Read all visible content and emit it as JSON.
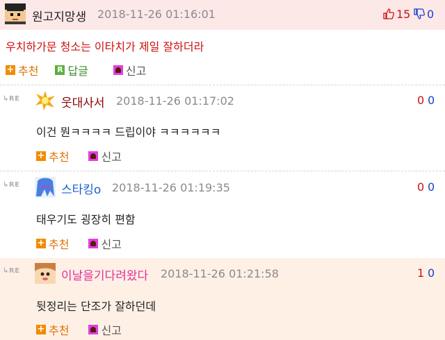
{
  "post": {
    "author": "원고지망생",
    "date": "2018-11-26 01:16:01",
    "like_count": "15",
    "dislike_count": "0",
    "text": "우치하가문 청소는 이타치가 제일 잘하더라",
    "recommend_label": "추천",
    "reply_label": "답글",
    "report_label": "신고"
  },
  "replies": [
    {
      "re_label": "RE",
      "author": "웃대사서",
      "date": "2018-11-26 01:17:02",
      "up": "0",
      "down": "0",
      "text": "이건 뭔ㅋㅋㅋㅋ 드립이야 ㅋㅋㅋㅋㅋㅋ",
      "recommend_label": "추천",
      "report_label": "신고"
    },
    {
      "re_label": "RE",
      "author": "스타킹o",
      "date": "2018-11-26 01:19:35",
      "up": "0",
      "down": "0",
      "text": "태우기도 굉장히 편함",
      "recommend_label": "추천",
      "report_label": "신고"
    },
    {
      "re_label": "RE",
      "author": "이날을기다려왔다",
      "date": "2018-11-26 01:21:58",
      "up": "1",
      "down": "0",
      "text": "뒷정리는 단조가 잘하던데",
      "recommend_label": "추천",
      "report_label": "신고"
    }
  ],
  "colors": {
    "post_header_bg": "#fde8e8",
    "highlight_reply_bg": "#fff0e6",
    "post_text": "#d01010",
    "like": "#d01010",
    "dislike": "#1a3fd0",
    "reply1_name": "#8b0000",
    "reply2_name": "#1a5fd0",
    "reply3_name": "#e0309a"
  },
  "icons": [
    "thumbs-up-icon",
    "thumbs-down-icon",
    "plus-icon",
    "reply-r-icon",
    "report-icon",
    "re-arrow-icon"
  ]
}
